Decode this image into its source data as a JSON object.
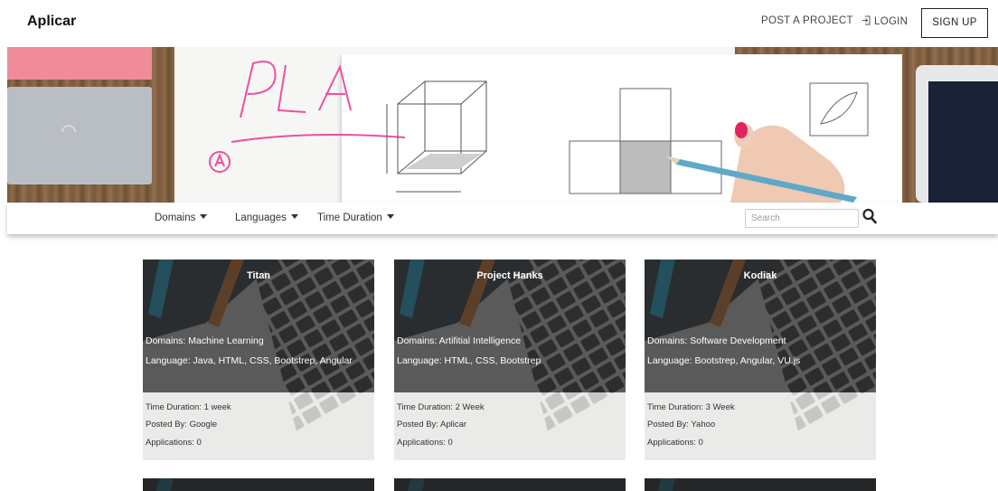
{
  "header": {
    "brand": "Aplicar",
    "post_project": "POST A PROJECT",
    "login": "LOGIN",
    "signup": "SIGN UP",
    "icons": {
      "login": "login-arrow-icon"
    }
  },
  "hero": {
    "image": "hand sketching cubes on paper over wooden desk",
    "handwriting": "PL",
    "circled_letter": "A"
  },
  "filters": {
    "domains": "Domains",
    "languages": "Languages",
    "time_duration": "Time Duration",
    "search_placeholder": "Search",
    "icons": {
      "dropdown": "caret-down-icon",
      "search": "search-icon"
    }
  },
  "cards": [
    {
      "title": "Titan",
      "domains": "Domains: Machine Learning",
      "language": "Language: Java, HTML, CSS, Bootstrep, Angular",
      "time": "Time Duration: 1 week",
      "posted": "Posted By: Google",
      "applications": "Applications: 0"
    },
    {
      "title": "Project Hanks",
      "domains": "Domains: Artifitial Intelligence",
      "language": "Language: HTML, CSS, Bootstrep",
      "time": "Time Duration: 2 Week",
      "posted": "Posted By: Aplicar",
      "applications": "Applications: 0"
    },
    {
      "title": "Kodiak",
      "domains": "Domains: Software Development",
      "language": "Language: Bootstrep, Angular, VU.js",
      "time": "Time Duration: 3 Week",
      "posted": "Posted By: Yahoo",
      "applications": "Applications: 0"
    }
  ],
  "card_background": "HTML & CSS book on laptop keyboard",
  "colors": {
    "card_dark_overlay": "#282828",
    "card_light_overlay": "#eeeeec",
    "hero_pink_ink": "#ee4fa0",
    "pencil": "#5fa8c8"
  }
}
